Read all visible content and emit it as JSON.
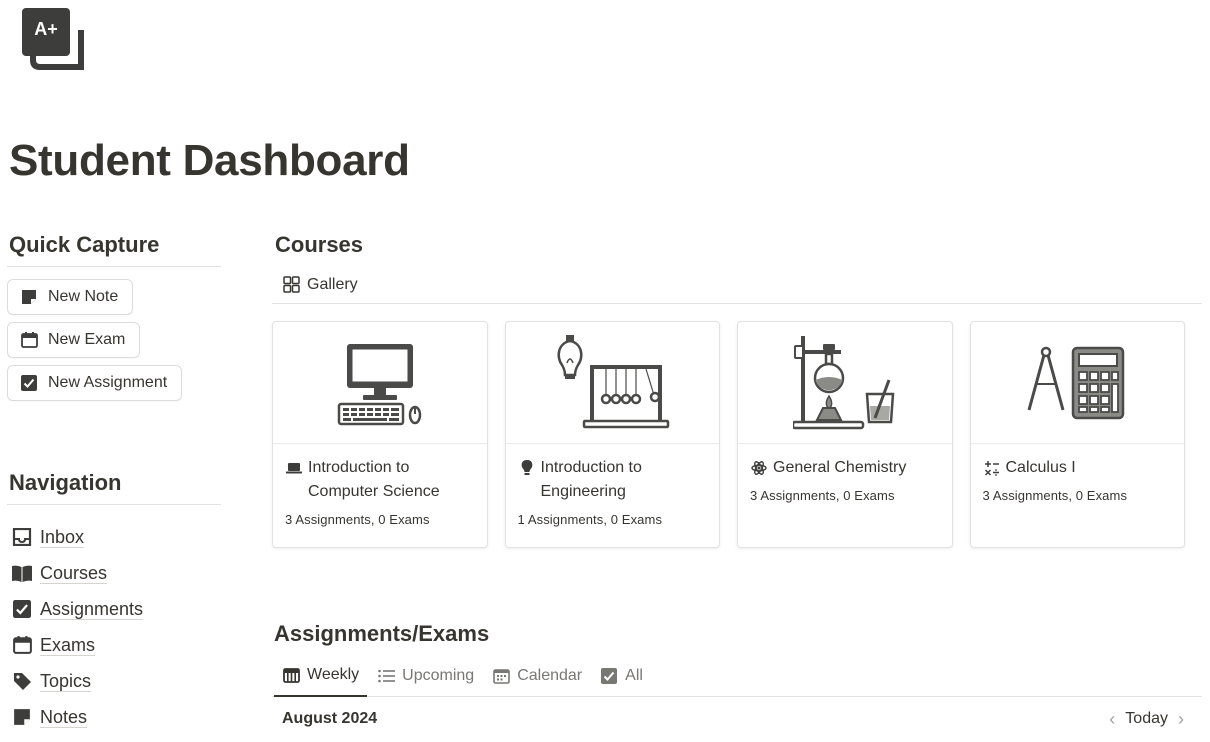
{
  "page": {
    "title": "Student Dashboard",
    "logo_text": "A+"
  },
  "quick_capture": {
    "heading": "Quick Capture",
    "buttons": [
      {
        "label": "New Note",
        "icon": "note-icon"
      },
      {
        "label": "New Exam",
        "icon": "calendar-icon"
      },
      {
        "label": "New Assignment",
        "icon": "checkbox-icon"
      }
    ]
  },
  "navigation": {
    "heading": "Navigation",
    "items": [
      {
        "label": "Inbox",
        "icon": "inbox-icon"
      },
      {
        "label": "Courses",
        "icon": "book-icon"
      },
      {
        "label": "Assignments",
        "icon": "checkbox-icon"
      },
      {
        "label": "Exams",
        "icon": "calendar-icon"
      },
      {
        "label": "Topics",
        "icon": "tag-icon"
      },
      {
        "label": "Notes",
        "icon": "note-icon"
      }
    ]
  },
  "courses": {
    "heading": "Courses",
    "view_tab": {
      "label": "Gallery",
      "icon": "gallery-grid-icon"
    },
    "cards": [
      {
        "title": "Introduction to Computer Science",
        "meta": "3 Assignments, 0 Exams",
        "icon": "laptop-icon",
        "cover": "computer-illustration"
      },
      {
        "title": "Introduction to Engineering",
        "meta": "1 Assignments, 0 Exams",
        "icon": "lightbulb-icon",
        "cover": "newtons-cradle-illustration"
      },
      {
        "title": "General Chemistry",
        "meta": "3 Assignments, 0 Exams",
        "icon": "atom-icon",
        "cover": "chemistry-illustration"
      },
      {
        "title": "Calculus I",
        "meta": "3 Assignments, 0 Exams",
        "icon": "math-operators-icon",
        "cover": "calculator-illustration"
      }
    ]
  },
  "assignments": {
    "heading": "Assignments/Exams",
    "tabs": [
      {
        "label": "Weekly",
        "icon": "calendar-week-icon",
        "active": true
      },
      {
        "label": "Upcoming",
        "icon": "list-icon",
        "active": false
      },
      {
        "label": "Calendar",
        "icon": "calendar-grid-icon",
        "active": false
      },
      {
        "label": "All",
        "icon": "checkbox-icon",
        "active": false
      }
    ],
    "month": "August 2024",
    "today_label": "Today",
    "prev_symbol": "‹",
    "next_symbol": "›"
  },
  "colors": {
    "text": "#37352f",
    "muted": "#787774",
    "border": "#e3e2e0",
    "icon_fill": "#4a4a48"
  }
}
